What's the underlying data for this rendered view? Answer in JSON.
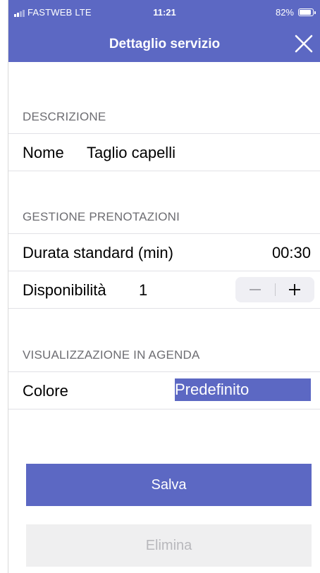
{
  "status_bar": {
    "carrier": "FASTWEB  LTE",
    "time": "11:21",
    "battery": "82%"
  },
  "nav": {
    "title": "Dettaglio servizio"
  },
  "sections": {
    "description": "DESCRIZIONE",
    "booking": "GESTIONE PRENOTAZIONI",
    "agenda": "VISUALIZZAZIONE IN AGENDA"
  },
  "fields": {
    "name_label": "Nome",
    "name_value": "Taglio capelli",
    "duration_label": "Durata standard (min)",
    "duration_value": "00:30",
    "availability_label": "Disponibilità",
    "availability_value": "1",
    "color_label": "Colore",
    "color_value": "Predefinito"
  },
  "buttons": {
    "save": "Salva",
    "delete": "Elimina"
  },
  "colors": {
    "accent": "#5c68c3",
    "section_text": "#6d6d72",
    "disabled_bg": "#efeff0",
    "disabled_text": "#b8b8bc"
  },
  "icons": {
    "close": "close-icon",
    "minus": "minus-icon",
    "plus": "plus-icon"
  }
}
